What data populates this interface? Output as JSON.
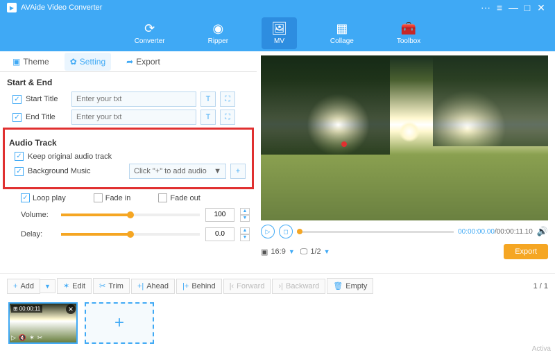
{
  "app": {
    "title": "AVAide Video Converter"
  },
  "mainnav": {
    "converter": "Converter",
    "ripper": "Ripper",
    "mv": "MV",
    "collage": "Collage",
    "toolbox": "Toolbox"
  },
  "tabs": {
    "theme": "Theme",
    "setting": "Setting",
    "export": "Export"
  },
  "startend": {
    "title": "Start & End",
    "start_label": "Start Title",
    "end_label": "End Title",
    "placeholder": "Enter your txt"
  },
  "audio": {
    "title": "Audio Track",
    "keep_original": "Keep original audio track",
    "bg_music": "Background Music",
    "dropdown": "Click \"+\" to add audio"
  },
  "playback_opts": {
    "loop": "Loop play",
    "fadein": "Fade in",
    "fadeout": "Fade out"
  },
  "sliders": {
    "volume_label": "Volume:",
    "volume_val": "100",
    "delay_label": "Delay:",
    "delay_val": "0.0"
  },
  "preview": {
    "time_cur": "00:00:00.00",
    "time_dur": "/00:00:11.10",
    "ratio": "16:9",
    "screen": "1/2"
  },
  "export_btn": "Export",
  "toolbar": {
    "add": "Add",
    "edit": "Edit",
    "trim": "Trim",
    "ahead": "Ahead",
    "behind": "Behind",
    "forward": "Forward",
    "backward": "Backward",
    "empty": "Empty",
    "page": "1 / 1"
  },
  "thumb": {
    "time": "00:00:11"
  },
  "watermark": "Activa"
}
